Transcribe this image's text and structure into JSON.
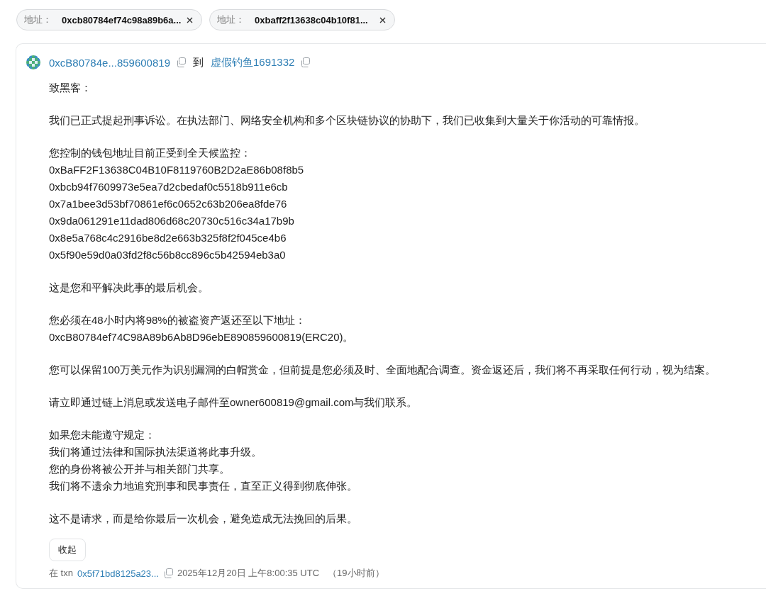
{
  "filters": [
    {
      "label": "地址：",
      "value": "0xcb80784ef74c98a89b6a..."
    },
    {
      "label": "地址：",
      "value": "0xbaff2f13638c04b10f81..."
    }
  ],
  "message": {
    "from": "0xcB80784e...859600819",
    "connector": "到",
    "to": "虚假钓鱼1691332",
    "paragraphs": [
      [
        "致黑客："
      ],
      [
        "我们已正式提起刑事诉讼。在执法部门、网络安全机构和多个区块链协议的协助下，我们已收集到大量关于你活动的可靠情报。"
      ],
      [
        "您控制的钱包地址目前正受到全天候监控：",
        "0xBaFF2F13638C04B10F8119760B2D2aE86b08f8b5",
        "0xbcb94f7609973e5ea7d2cbedaf0c5518b911e6cb",
        "0x7a1bee3d53bf70861ef6c0652c63b206ea8fde76",
        "0x9da061291e11dad806d68c20730c516c34a17b9b",
        "0x8e5a768c4c2916be8d2e663b325f8f2f045ce4b6",
        "0x5f90e59d0a03fd2f8c56b8cc896c5b42594eb3a0"
      ],
      [
        "这是您和平解决此事的最后机会。"
      ],
      [
        "您必须在48小时内将98%的被盗资产返还至以下地址：",
        "0xcB80784ef74C98A89b6Ab8D96ebE890859600819(ERC20)。"
      ],
      [
        "您可以保留100万美元作为识别漏洞的白帽赏金，但前提是您必须及时、全面地配合调查。资金返还后，我们将不再采取任何行动，视为结案。"
      ],
      [
        "请立即通过链上消息或发送电子邮件至owner600819@gmail.com与我们联系。"
      ],
      [
        "如果您未能遵守规定：",
        "我们将通过法律和国际执法渠道将此事升级。",
        "您的身份将被公开并与相关部门共享。",
        "我们将不遗余力地追究刑事和民事责任，直至正义得到彻底伸张。"
      ],
      [
        "这不是请求，而是给你最后一次机会，避免造成无法挽回的后果。"
      ]
    ],
    "collapse_button": "收起",
    "footer": {
      "prefix": "在 txn",
      "txn": "0x5f71bd8125a23...",
      "timestamp": "2025年12月20日 上午8:00:35 UTC",
      "relative": "（19小时前）"
    }
  }
}
